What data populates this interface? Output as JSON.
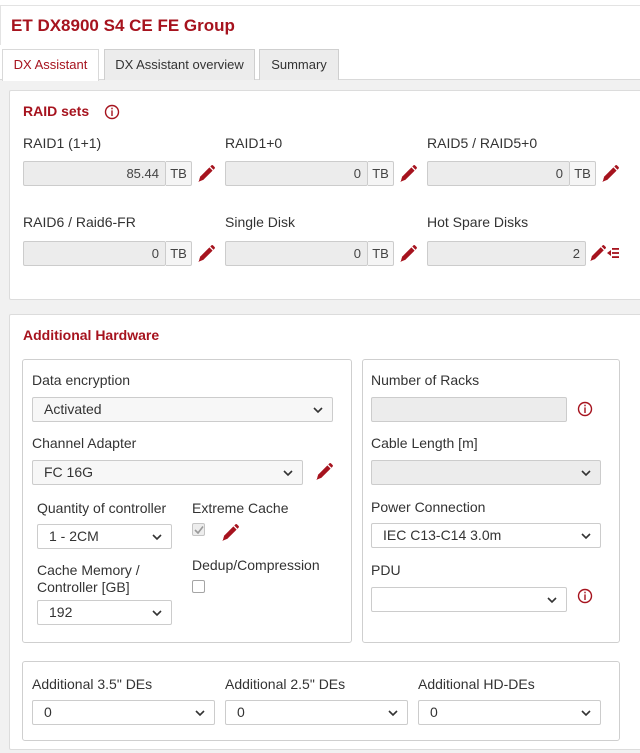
{
  "window": {
    "title": "ET DX8900 S4 CE FE Group"
  },
  "tabs": [
    {
      "label": "DX Assistant",
      "active": true
    },
    {
      "label": "DX Assistant overview",
      "active": false
    },
    {
      "label": "Summary",
      "active": false
    }
  ],
  "raid_sets": {
    "title": "RAID sets",
    "fields": [
      {
        "label": "RAID1 (1+1)",
        "value": "85.44",
        "unit": "TB"
      },
      {
        "label": "RAID1+0",
        "value": "0",
        "unit": "TB"
      },
      {
        "label": "RAID5 / RAID5+0",
        "value": "0",
        "unit": "TB"
      },
      {
        "label": "RAID6 / Raid6-FR",
        "value": "0",
        "unit": "TB"
      },
      {
        "label": "Single Disk",
        "value": "0",
        "unit": "TB"
      },
      {
        "label": "Hot Spare Disks",
        "value": "2"
      }
    ]
  },
  "additional_hardware": {
    "title": "Additional Hardware",
    "data_encryption": {
      "label": "Data encryption",
      "value": "Activated"
    },
    "channel_adapter": {
      "label": "Channel Adapter",
      "value": "FC 16G"
    },
    "quantity_of_controller": {
      "label": "Quantity of controller",
      "value": "1 - 2CM"
    },
    "extreme_cache": {
      "label": "Extreme Cache",
      "checked": true,
      "disabled": true
    },
    "cache_memory": {
      "label_line1": "Cache Memory /",
      "label_line2": "Controller [GB]",
      "value": "192"
    },
    "dedup": {
      "label": "Dedup/Compression",
      "checked": false
    },
    "number_of_racks": {
      "label": "Number of Racks",
      "value": ""
    },
    "cable_length": {
      "label": "Cable Length [m]",
      "value": ""
    },
    "power_connection": {
      "label": "Power Connection",
      "value": "IEC C13-C14 3.0m"
    },
    "pdu": {
      "label": "PDU",
      "value": ""
    }
  },
  "des": {
    "de35": {
      "label": "Additional 3.5\" DEs",
      "value": "0"
    },
    "de25": {
      "label": "Additional 2.5\" DEs",
      "value": "0"
    },
    "hd": {
      "label": "Additional HD-DEs",
      "value": "0"
    }
  },
  "colors": {
    "accent": "#a6131e",
    "field_bg": "#ececec",
    "border": "#cccccc"
  },
  "icons": [
    "info-icon",
    "pencil-icon",
    "pencil-list-icon",
    "chevron-down-icon"
  ]
}
